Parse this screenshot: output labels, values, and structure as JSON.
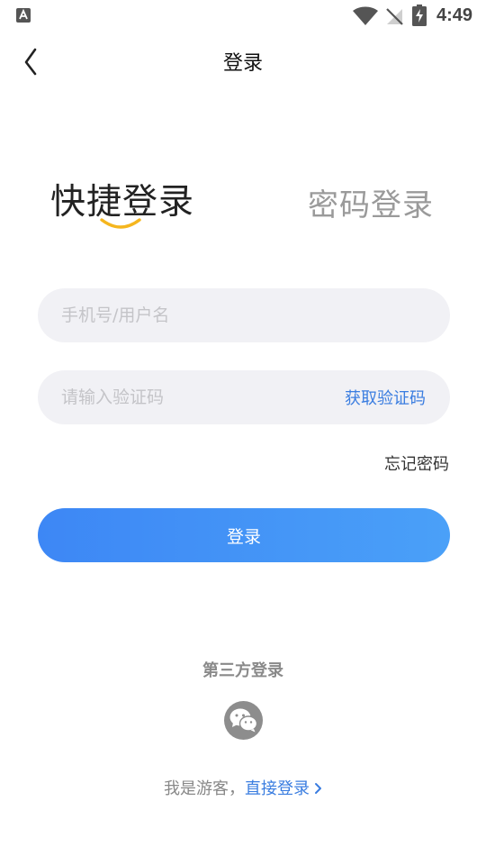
{
  "status_bar": {
    "time": "4:49",
    "notification_icon": "a-icon",
    "wifi_icon": "wifi-icon",
    "signal_icon": "no-signal-icon",
    "battery_icon": "battery-charging-icon"
  },
  "header": {
    "title": "登录",
    "back_icon": "chevron-left-icon"
  },
  "tabs": {
    "quick_label": "快捷登录",
    "password_label": "密码登录",
    "active": "quick",
    "underline_color": "#f5b61e"
  },
  "form": {
    "phone_placeholder": "手机号/用户名",
    "phone_value": "",
    "code_placeholder": "请输入验证码",
    "code_value": "",
    "get_code_label": "获取验证码",
    "forgot_label": "忘记密码",
    "login_label": "登录"
  },
  "third_party": {
    "title": "第三方登录",
    "wechat_icon": "wechat-icon"
  },
  "guest": {
    "text": "我是游客，",
    "link_label": "直接登录"
  },
  "colors": {
    "accent": "#3a7de0",
    "button_start": "#3d87f5",
    "button_end": "#4aa0f8",
    "input_bg": "#f1f1f5",
    "inactive_tab": "#9a9a9a"
  }
}
